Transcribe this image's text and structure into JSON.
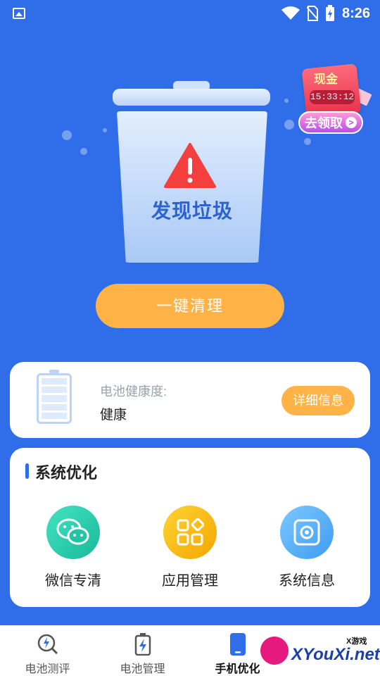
{
  "status_bar": {
    "time": "8:26",
    "icons": [
      "gallery-icon",
      "wifi-icon",
      "no-sim-icon",
      "battery-charging-icon"
    ]
  },
  "hero": {
    "status_text": "发现垃圾",
    "icon": "warning-icon"
  },
  "reward": {
    "cash_label": "现金",
    "countdown": "15:33:12",
    "claim_label": "去领取",
    "claim_arrow": ">"
  },
  "clean_button": {
    "label": "一键清理"
  },
  "battery_card": {
    "label": "电池健康度:",
    "value": "健康",
    "detail_button": "详细信息"
  },
  "system_card": {
    "title": "系统优化",
    "tools": [
      {
        "label": "微信专清",
        "icon": "wechat-icon"
      },
      {
        "label": "应用管理",
        "icon": "app-grid-icon"
      },
      {
        "label": "系统信息",
        "icon": "settings-icon"
      }
    ]
  },
  "bottom_nav": {
    "items": [
      {
        "label": "电池测评",
        "icon": "battery-test-icon",
        "active": false
      },
      {
        "label": "电池管理",
        "icon": "battery-manage-icon",
        "active": false
      },
      {
        "label": "手机优化",
        "icon": "phone-icon",
        "active": true
      },
      {
        "label": "",
        "icon": "profile-icon",
        "active": false
      }
    ]
  },
  "watermark": {
    "small": "X游戏",
    "text": "XYouXi.net"
  },
  "colors": {
    "background": "#2f6ee8",
    "accent_orange": "#ffb347",
    "text_primary": "#222222",
    "text_muted": "#9aa3ad"
  }
}
